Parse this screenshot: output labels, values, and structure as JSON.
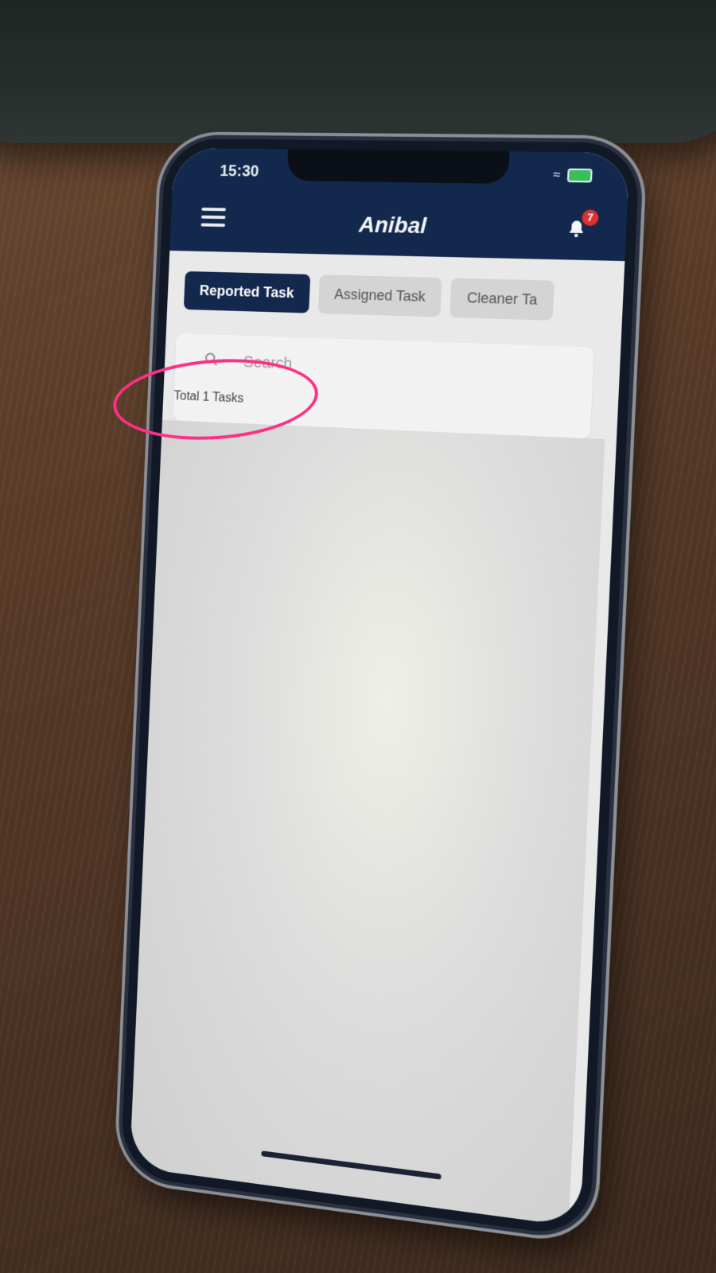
{
  "status_bar": {
    "time": "15:30"
  },
  "header": {
    "title": "Anibal",
    "notification_count": "7",
    "menu_icon": "hamburger-menu-icon",
    "bell_icon": "bell-icon"
  },
  "tabs": [
    {
      "label": "Reported Task",
      "active": true
    },
    {
      "label": "Assigned Task",
      "active": false
    },
    {
      "label": "Cleaner Ta",
      "active": false
    }
  ],
  "search": {
    "placeholder": "Search",
    "value": ""
  },
  "list": {
    "total_label": "Total 1 Tasks"
  },
  "colors": {
    "header_bg": "#13284d",
    "active_tab_bg": "#13284d",
    "badge_bg": "#e0302f",
    "annotation": "#ff2f86"
  }
}
